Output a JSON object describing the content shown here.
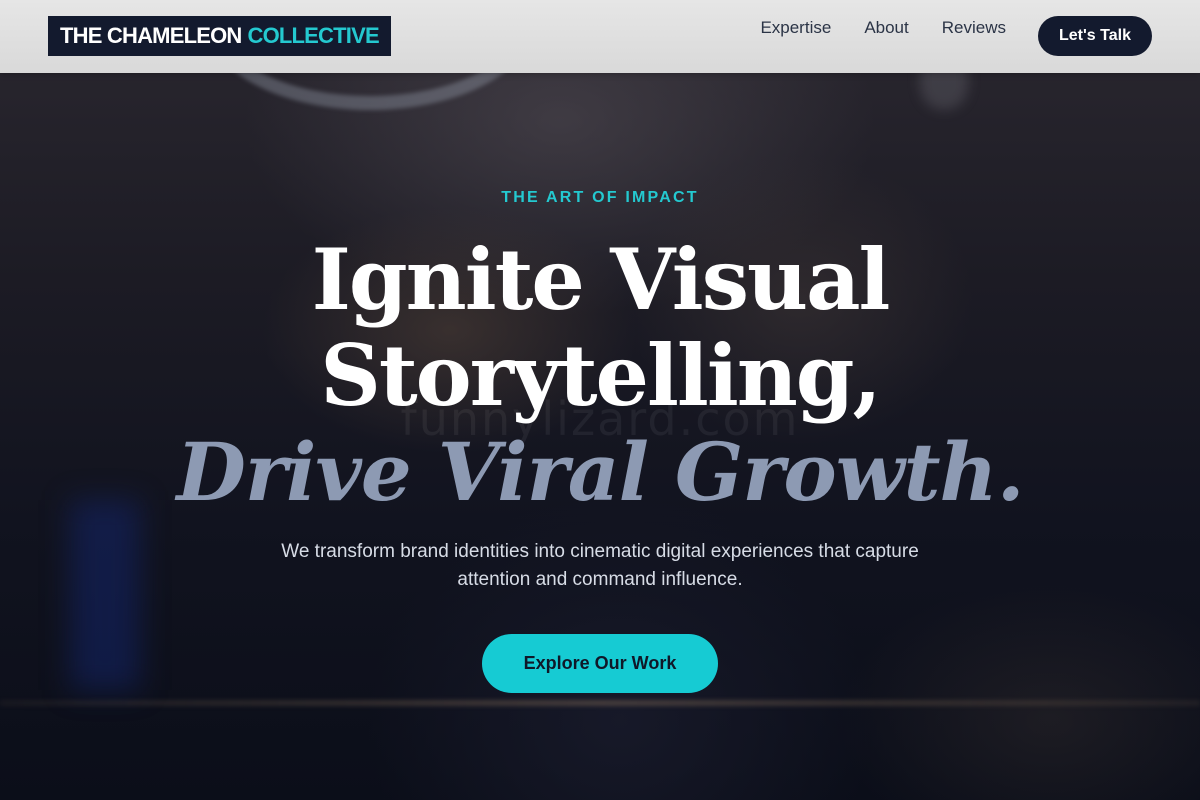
{
  "header": {
    "logo_main": "THE CHAMELEON",
    "logo_accent": "COLLECTIVE",
    "nav": [
      {
        "label": "Expertise"
      },
      {
        "label": "About"
      },
      {
        "label": "Reviews"
      }
    ],
    "cta_label": "Let's Talk"
  },
  "hero": {
    "eyebrow": "THE ART OF IMPACT",
    "headline_line1": "Ignite Visual",
    "headline_line2": "Storytelling,",
    "headline_accent": "Drive Viral Growth.",
    "subtext": "We transform brand identities into cinematic digital experiences that capture attention and command influence.",
    "cta_label": "Explore Our Work",
    "watermark": "funnylizard.com"
  },
  "colors": {
    "accent": "#24c9d0",
    "navy": "#131a2e",
    "headline_accent": "#8d9ab3"
  }
}
